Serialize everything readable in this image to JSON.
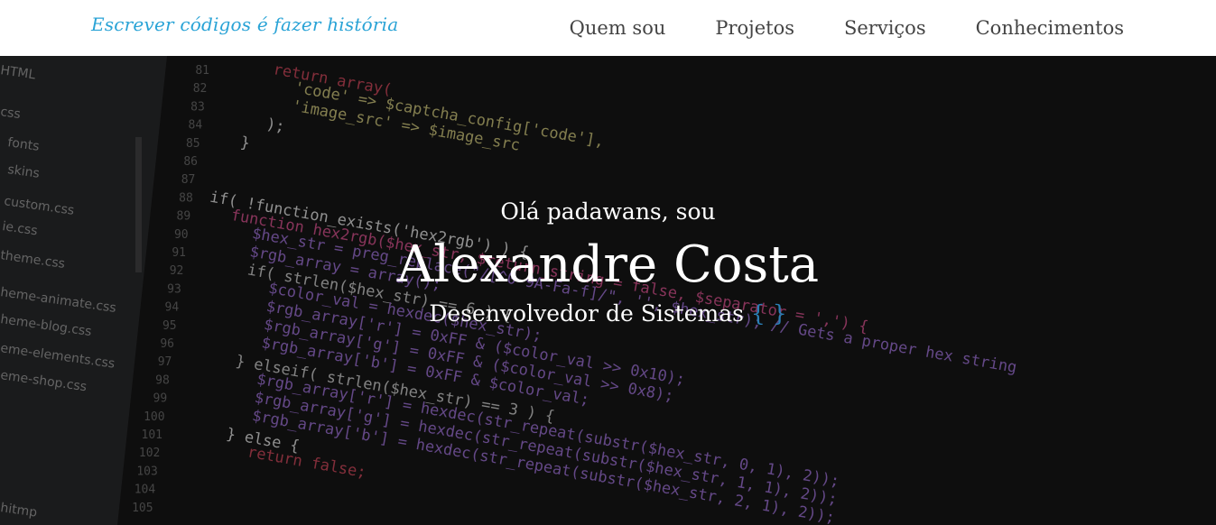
{
  "brand": {
    "tagline": "Escrever códigos é fazer história"
  },
  "nav": {
    "items": [
      {
        "label": "Quem sou"
      },
      {
        "label": "Projetos"
      },
      {
        "label": "Serviços"
      },
      {
        "label": "Conhecimentos"
      }
    ]
  },
  "hero": {
    "greeting": "Olá padawans, sou",
    "name": "Alexandre Costa",
    "role": "Desenvolvedor de Sistemas",
    "role_accent": "{ }"
  },
  "sidebar": {
    "items": [
      "HTML",
      "css",
      "fonts",
      "skins",
      "custom.css",
      "ie.css",
      "theme.css",
      "heme-animate.css",
      "heme-blog.css",
      "eme-elements.css",
      "eme-shop.css",
      "hitmp"
    ]
  },
  "code": {
    "line_numbers": [
      "81",
      "82",
      "83",
      "84",
      "85",
      "86",
      "87",
      "88",
      "89",
      "90",
      "91",
      "92",
      "93",
      "94",
      "95",
      "96",
      "97",
      "98",
      "99",
      "100",
      "101",
      "102",
      "103",
      "104",
      "105"
    ],
    "lines": [
      "return array(",
      "'code' => $captcha_config['code'],",
      "'image_src' => $image_src",
      ");",
      "}",
      "",
      "",
      "if( !function_exists('hex2rgb') ) {",
      "function hex2rgb($hex_str, $return_string = false, $separator = ',') {",
      "$hex_str = preg_replace(\"/[^0-9A-Fa-f]/\", '', $hex_str); // Gets a proper hex string",
      "$rgb_array = array();",
      "if( strlen($hex_str) == 6 ) {",
      "$color_val = hexdec($hex_str);",
      "$rgb_array['r'] = 0xFF & ($color_val >> 0x10);",
      "$rgb_array['g'] = 0xFF & ($color_val >> 0x8);",
      "$rgb_array['b'] = 0xFF & $color_val;",
      "} elseif( strlen($hex_str) == 3 ) {",
      "$rgb_array['r'] = hexdec(str_repeat(substr($hex_str, 0, 1), 2));",
      "$rgb_array['g'] = hexdec(str_repeat(substr($hex_str, 1, 1), 2));",
      "$rgb_array['b'] = hexdec(str_repeat(substr($hex_str, 2, 1), 2));",
      "} else {",
      "return false;"
    ]
  }
}
